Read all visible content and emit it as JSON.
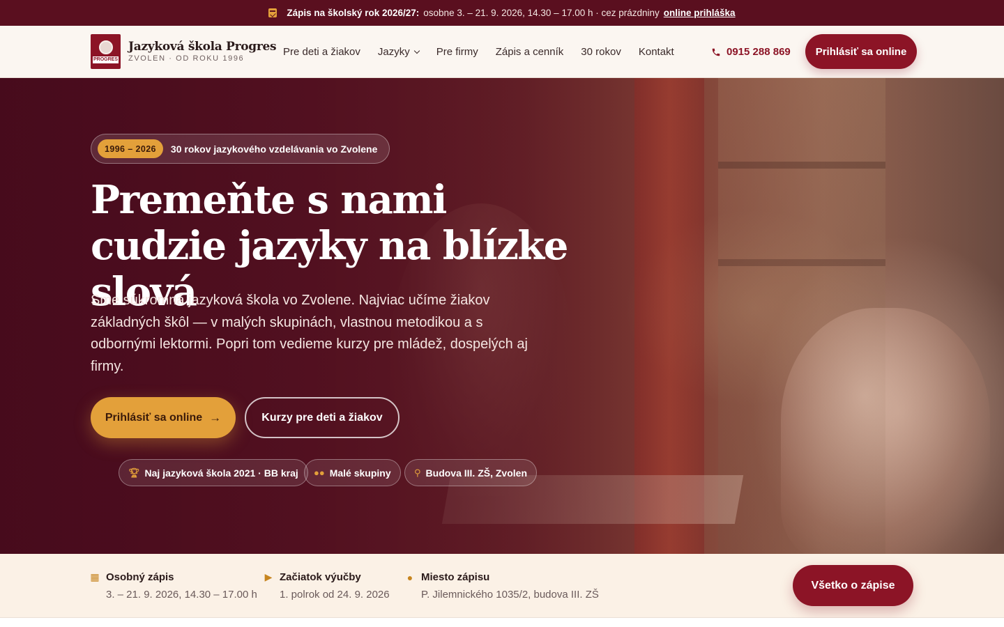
{
  "topbar": {
    "label": "Zápis na školský rok 2026/27:",
    "text": "osobne 3. – 21. 9. 2026, 14.30 – 17.00 h · cez prázdniny",
    "link": "online prihláška"
  },
  "header": {
    "logo_mark_text": "PROGRES",
    "logo_title": "Jazyková škola Progres",
    "logo_sub": "ZVOLEN · OD ROKU 1996",
    "nav": [
      "Pre deti a žiakov",
      "Jazyky",
      "Pre firmy",
      "Zápis a cenník",
      "30 rokov",
      "Kontakt"
    ],
    "phone": "0915 288 869",
    "cta": "Prihlásiť sa online"
  },
  "hero": {
    "pill_years": "1996 – 2026",
    "pill_text": "30 rokov jazykového vzdelávania vo Zvolene",
    "headline": "Premeňte s nami cudzie jazyky na blízke slová",
    "lead": "Sme súkromná jazyková škola vo Zvolene. Najviac učíme žiakov základných škôl — v malých skupinách, vlastnou metodikou a s odbornými lektormi. Popri tom vedieme kurzy pre mládež, dospelých aj firmy.",
    "btn_primary": "Prihlásiť sa online",
    "btn_secondary": "Kurzy pre deti a žiakov",
    "chips": [
      "Naj jazyková škola 2021 · BB kraj",
      "Malé skupiny",
      "Budova III. ZŠ, Zvolen"
    ]
  },
  "info": {
    "items": [
      {
        "title": "Osobný zápis",
        "text": "3. – 21. 9. 2026, 14.30 – 17.00 h",
        "icon": "calendar-icon"
      },
      {
        "title": "Začiatok výučby",
        "text": "1. polrok od 24. 9. 2026",
        "icon": "play-icon"
      },
      {
        "title": "Miesto zápisu",
        "text": "P. Jilemnického 1035/2, budova III. ZŠ",
        "icon": "map-pin-icon"
      }
    ],
    "cta": "Všetko o zápise"
  },
  "colors": {
    "brand": "#8c1426",
    "accent": "#e3a03a",
    "topbar": "#5a0f1f"
  }
}
